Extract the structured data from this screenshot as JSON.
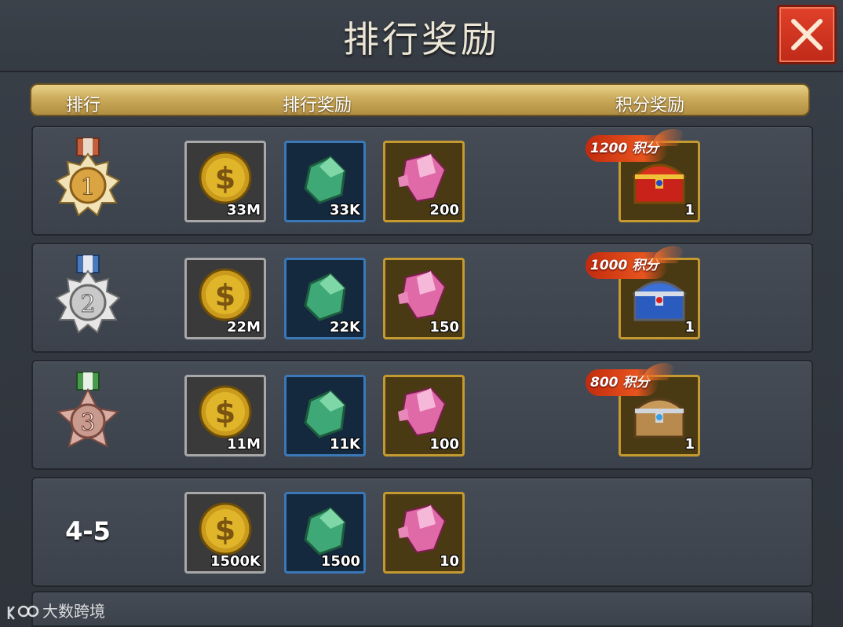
{
  "title": "排行奖励",
  "header": {
    "rank": "排行",
    "rank_reward": "排行奖励",
    "points_reward": "积分奖励"
  },
  "rows": [
    {
      "rank": "1",
      "medal_color": "#d9a441",
      "rewards": {
        "gold": "33M",
        "ore": "33K",
        "gem": "200"
      },
      "points_badge": "1200 积分",
      "chest": {
        "icon": "red-gold-treasure-chest-icon",
        "qty": "1"
      }
    },
    {
      "rank": "2",
      "medal_color": "#c9c9c9",
      "rewards": {
        "gold": "22M",
        "ore": "22K",
        "gem": "150"
      },
      "points_badge": "1000 积分",
      "chest": {
        "icon": "blue-silver-treasure-chest-icon",
        "qty": "1"
      }
    },
    {
      "rank": "3",
      "medal_color": "#c99a8e",
      "rewards": {
        "gold": "11M",
        "ore": "11K",
        "gem": "100"
      },
      "points_badge": "800 积分",
      "chest": {
        "icon": "wooden-treasure-chest-icon",
        "qty": "1"
      }
    },
    {
      "rank": "4-5",
      "rewards": {
        "gold": "1500K",
        "ore": "1500",
        "gem": "10"
      }
    }
  ],
  "watermark": "大数跨境",
  "colors": {
    "header_gold": "#c9a858",
    "close_red": "#d43a22",
    "slot_gold_border": "#c49a30",
    "slot_blue_border": "#3a78b8",
    "slot_grey_border": "#a8a8a8"
  }
}
